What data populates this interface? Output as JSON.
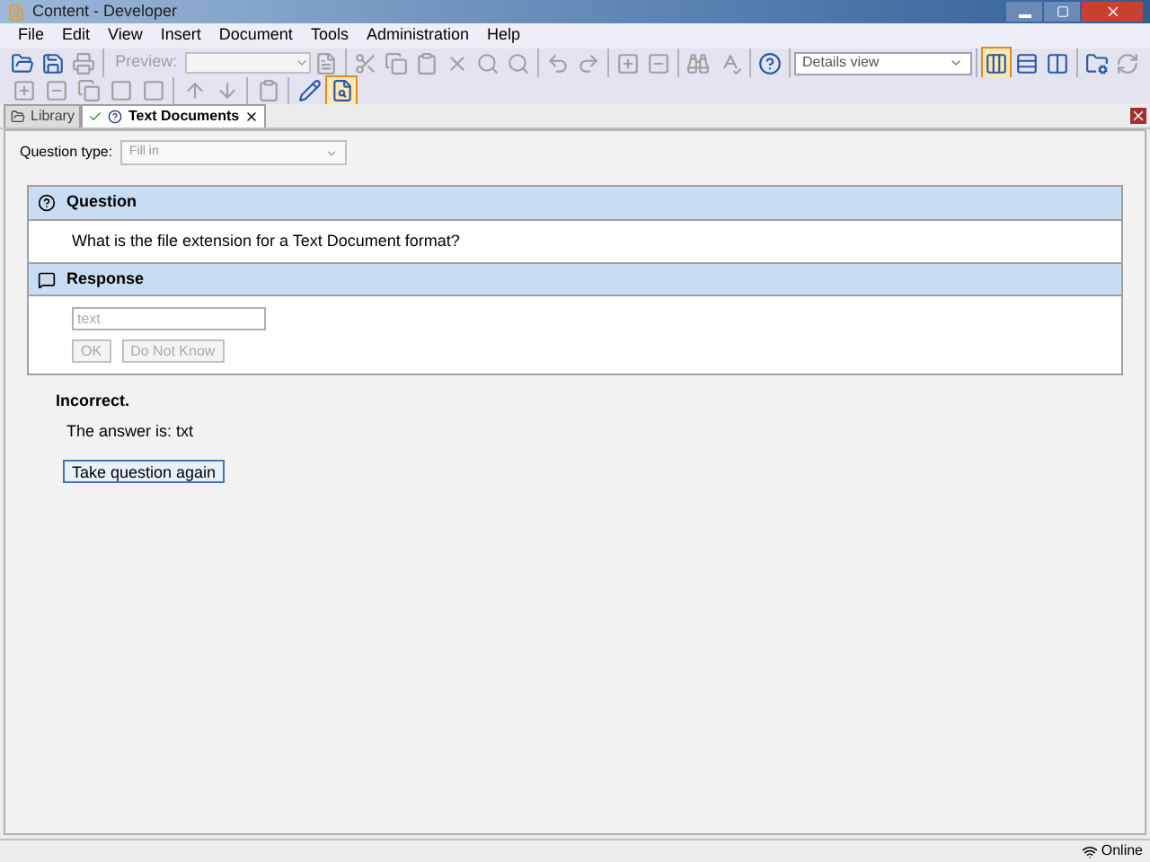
{
  "window": {
    "title": "Content - Developer"
  },
  "menu": [
    "File",
    "Edit",
    "View",
    "Insert",
    "Document",
    "Tools",
    "Administration",
    "Help"
  ],
  "toolbar": {
    "left_icons": [
      {
        "disabled": false
      },
      {
        "disabled": false
      },
      {
        "disabled": true
      }
    ],
    "preview_label": {
      "text": "Preview:",
      "disabled": true
    },
    "mid_icons": [
      {
        "disabled": true
      },
      {
        "disabled": true
      },
      {
        "disabled": true
      },
      {
        "disabled": true
      },
      {
        "disabled": true
      },
      {
        "disabled": true
      },
      {
        "disabled": true
      },
      {
        "disabled": true
      },
      {
        "disabled": true
      },
      {
        "disabled": true
      },
      {
        "disabled": true
      },
      {
        "disabled": true
      },
      {
        "disabled": true
      },
      {
        "disabled": false
      }
    ],
    "view_select": "Details view",
    "view_buttons": [
      {
        "selected": true
      },
      {
        "selected": false
      },
      {
        "selected": false
      }
    ],
    "right_icons": [
      {
        "disabled": false
      },
      {
        "disabled": true
      }
    ]
  },
  "toolbar2": [
    {
      "disabled": true
    },
    {
      "disabled": true
    },
    {
      "disabled": true
    },
    {
      "disabled": true
    },
    {
      "disabled": true
    },
    {
      "disabled": true
    },
    {
      "disabled": true
    },
    {
      "disabled": true
    },
    {
      "disabled": false
    },
    {
      "selected": true,
      "disabled": false
    }
  ],
  "tabs": [
    {
      "label": "Library",
      "selected": false
    },
    {
      "label": "Text Documents",
      "selected": true
    }
  ],
  "question_type": {
    "label": "Question type:",
    "value": "Fill in"
  },
  "question": {
    "title": "Question",
    "text": "What is the file extension for a Text Document format?"
  },
  "response": {
    "title": "Response",
    "placeholder": "text",
    "buttons": [
      "OK",
      "Do Not Know"
    ]
  },
  "result": {
    "heading": "Incorrect.",
    "answer": "The answer is: txt",
    "button": "Take question again"
  },
  "status_bar": {
    "status": "Online"
  }
}
